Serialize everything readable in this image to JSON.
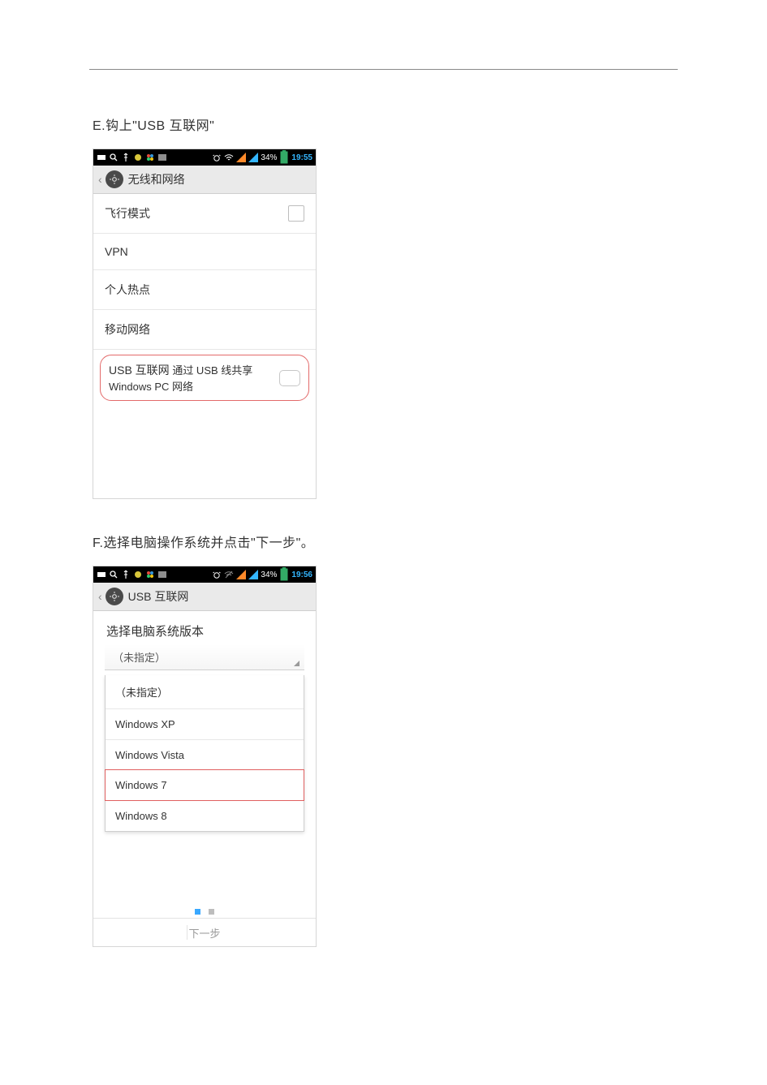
{
  "steps": {
    "e": {
      "caption": "E.钩上\"USB 互联网\""
    },
    "f": {
      "caption": "F.选择电脑操作系统并点击\"下一步\"。"
    }
  },
  "status": {
    "battery_pct": "34%",
    "time1": "19:55",
    "time2": "19:56"
  },
  "screen1": {
    "title": "无线和网络",
    "rows": {
      "airplane": "飞行模式",
      "vpn": "VPN",
      "hotspot": "个人热点",
      "mobile": "移动网络"
    },
    "usb": {
      "title": "USB 互联网",
      "sub": "通过 USB 线共享 Windows PC 网络"
    }
  },
  "screen2": {
    "title": "USB 互联网",
    "heading": "选择电脑系统版本",
    "current": "（未指定）",
    "options": {
      "o0": "（未指定）",
      "o1": "Windows XP",
      "o2": "Windows Vista",
      "o3": "Windows 7",
      "o4": "Windows 8"
    },
    "next_label": "下一步"
  }
}
